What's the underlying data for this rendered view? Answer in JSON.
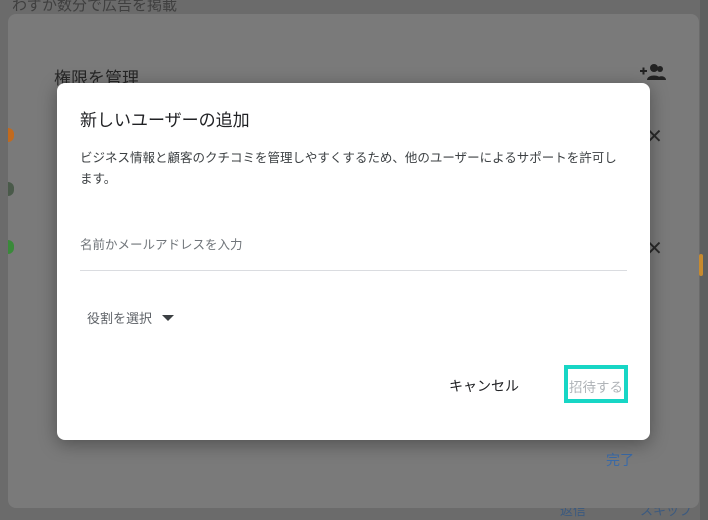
{
  "background": {
    "top_text": "わずか数分で広告を掲載",
    "bottom_text_left": "",
    "bottom_text_mid": "返信",
    "bottom_text_right": "スキップ"
  },
  "outer_panel": {
    "title": "権限を管理",
    "done_label": "完了",
    "add_person_icon": "person-add-icon",
    "close_icon": "close-icon"
  },
  "dialog": {
    "title": "新しいユーザーの追加",
    "description": "ビジネス情報と顧客のクチコミを管理しやすくするため、他のユーザーによるサポートを許可します。",
    "name_input": {
      "placeholder": "名前かメールアドレスを入力",
      "value": ""
    },
    "role_select": {
      "label": "役割を選択",
      "icon": "caret-down-icon"
    },
    "cancel_label": "キャンセル",
    "invite_label": "招待する",
    "invite_enabled": false
  },
  "colors": {
    "highlight": "#17d6c5",
    "dialog_bg": "#ffffff",
    "overlay": "#7a7a7a",
    "link_blue": "#3a6aa8",
    "orange_accent": "#c88a2e",
    "green_accent": "#3a8a3a"
  }
}
